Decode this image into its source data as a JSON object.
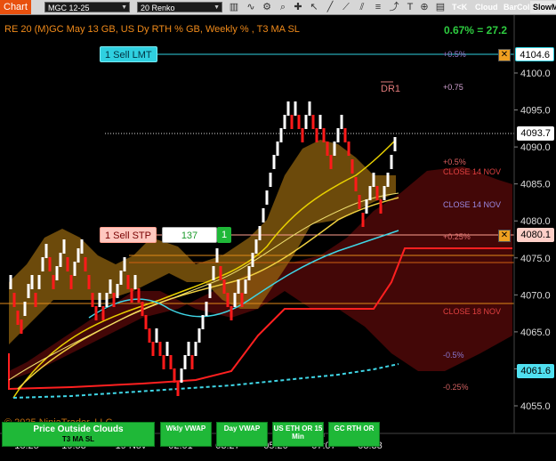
{
  "toolbar": {
    "tab_label": "Chart",
    "instrument": "MGC 12-25",
    "bar_type": "20 Renko",
    "buttons": {
      "tk": "T<K",
      "cloud": "Cloud",
      "barcol": "BarCol",
      "slowm": "SlowM"
    },
    "colors": {
      "tk": "#f0a020",
      "cloud": "#e0001a",
      "barcol": "#f07800"
    }
  },
  "chart": {
    "title": "RE 20  (M)GC May 13 GB, US Dy RTH % GB, Weekly % , T3 MA SL",
    "pct_readout": "0.67% = 27.2",
    "dr1_label": "DR1",
    "copyright": "© 2025 NinjaTrader, LLC",
    "y_axis_ticks": [
      "4100.0",
      "4095.0",
      "4090.0",
      "4085.0",
      "4080.0",
      "4075.0",
      "4070.0",
      "4065.0",
      "4060.0",
      "4055.0"
    ],
    "x_axis_ticks": [
      "18:25",
      "19:53",
      "19 Nov",
      "02:01",
      "03:27",
      "05:20",
      "07:07",
      "08:33"
    ],
    "price_labels": {
      "limit": "4104.6",
      "last": "4093.7",
      "stop": "4080.1",
      "cyan": "4061.6"
    },
    "level_labels": {
      "plus_05_top": "+0.5%",
      "plus_075": "+0.75",
      "plus_05": "+0.5%",
      "close_14_nov_red": "CLOSE 14 NOV",
      "close_14_nov_purple": "CLOSE 14 NOV",
      "plus_025": "+0.25%",
      "close_18_nov": "CLOSE 18 NOV",
      "minus_05": "-0.5%",
      "minus_025": "-0.25%"
    },
    "orders": {
      "sell_limit": "1 Sell LMT",
      "sell_stop": "1 Sell STP",
      "stop_qty_pending": "137",
      "stop_qty": "1"
    },
    "indicator_buttons": {
      "price_outside": "Price Outside Clouds",
      "t3_ma_sl": "T3 MA SL",
      "wkly_vwap": "Wkly VWAP",
      "day_vwap": "Day VWAP",
      "us_eth_or": "US ETH OR 15 Min",
      "gc_rth_or": "GC RTH OR"
    },
    "colors": {
      "up_bar": "#ffffff",
      "down_bar": "#ff1a1a",
      "cloud_gold": "#9a6a10",
      "cloud_red": "#5a0a0a",
      "ma_yellow": "#e8d000",
      "vwap_cyan": "#3fd6e6",
      "orange_level": "#e08a1a"
    }
  }
}
